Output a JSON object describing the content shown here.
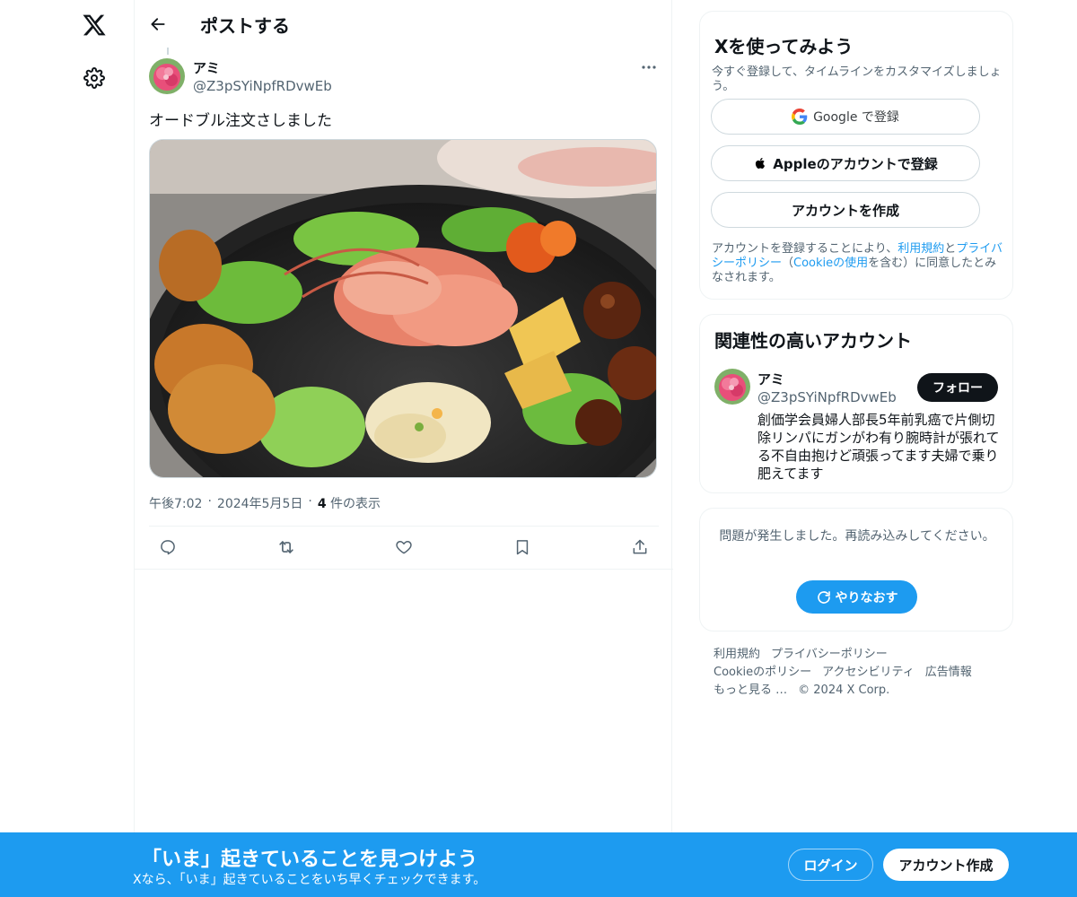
{
  "nav": {
    "logo_icon": "x-logo-icon",
    "settings_icon": "gear-icon"
  },
  "header": {
    "back_icon": "arrow-left-icon",
    "title": "ポストする"
  },
  "post": {
    "author_name": "アミ",
    "author_handle": "@Z3pSYiNpfRDvwEb",
    "text": "オードブル注文さしました",
    "time": "午後7:02",
    "date": "2024年5月5日",
    "sep": "·",
    "views_count": "4",
    "views_label": "件の表示",
    "image_alt": "オードブルの写真"
  },
  "actions": [
    {
      "name": "reply",
      "icon": "reply-icon"
    },
    {
      "name": "repost",
      "icon": "repost-icon"
    },
    {
      "name": "like",
      "icon": "heart-icon"
    },
    {
      "name": "bookmark",
      "icon": "bookmark-icon"
    },
    {
      "name": "share",
      "icon": "share-icon"
    }
  ],
  "signup": {
    "title": "Xを使ってみよう",
    "subtitle": "今すぐ登録して、タイムラインをカスタマイズしましょう。",
    "google_label": "Google で登録",
    "apple_label": "Appleのアカウントで登録",
    "create_label": "アカウントを作成",
    "terms_pre": "アカウントを登録することにより、",
    "terms_link1": "利用規約",
    "terms_and": "と",
    "terms_link2": "プライバシーポリシー",
    "terms_mid": "（",
    "terms_link3": "Cookieの使用",
    "terms_post": "を含む）に同意したとみなされます。"
  },
  "relevant": {
    "title": "関連性の高いアカウント",
    "name": "アミ",
    "handle": "@Z3pSYiNpfRDvwEb",
    "follow_label": "フォロー",
    "bio": "創価学会員婦人部長5年前乳癌で片側切除リンパにガンがわ有り腕時計が張れてる不自由抱けど頑張ってます夫婦で乗り肥えてます"
  },
  "error": {
    "message": "問題が発生しました。再読み込みしてください。",
    "retry_label": "やりなおす"
  },
  "footer": {
    "terms": "利用規約",
    "privacy": "プライバシーポリシー",
    "cookie": "Cookieのポリシー",
    "accessibility": "アクセシビリティ",
    "ads": "広告情報",
    "more": "もっと見る …",
    "copyright": "© 2024 X Corp."
  },
  "banner": {
    "title": "「いま」起きていることを見つけよう",
    "subtitle": "Xなら、「いま」起きていることをいち早くチェックできます。",
    "login_label": "ログイン",
    "signup_label": "アカウント作成"
  },
  "colors": {
    "accent": "#1d9bf0",
    "text": "#0f1419",
    "secondary": "#536471",
    "border": "#eff3f4"
  }
}
